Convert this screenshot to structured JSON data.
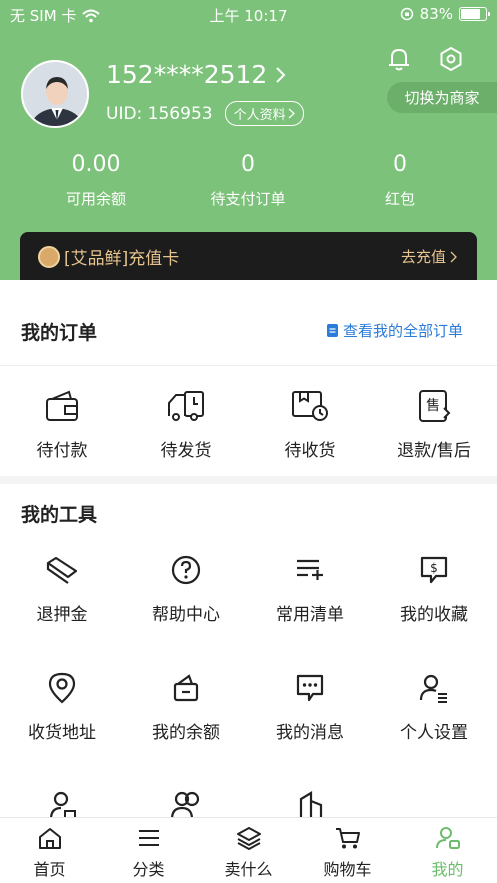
{
  "status_bar": {
    "carrier": "无 SIM 卡",
    "time": "上午 10:17",
    "battery": "83%",
    "battery_level": 0.83
  },
  "profile": {
    "phone": "152****2512",
    "uid": "UID: 156953",
    "profile_chip": "个人资料",
    "switch_label": "切换为商家"
  },
  "stats": [
    {
      "value": "0.00",
      "label": "可用余额"
    },
    {
      "value": "0",
      "label": "待支付订单"
    },
    {
      "value": "0",
      "label": "红包"
    }
  ],
  "recharge": {
    "label": "[艾品鲜]充值卡",
    "action": "去充值"
  },
  "orders": {
    "title": "我的订单",
    "view_all": "查看我的全部订单",
    "items": [
      {
        "label": "待付款",
        "icon": "wallet-icon"
      },
      {
        "label": "待发货",
        "icon": "truck-icon"
      },
      {
        "label": "待收货",
        "icon": "receive-icon"
      },
      {
        "label": "退款/售后",
        "icon": "after-sale-icon"
      }
    ]
  },
  "tools": {
    "title": "我的工具",
    "items": [
      {
        "label": "退押金",
        "icon": "deposit-icon"
      },
      {
        "label": "帮助中心",
        "icon": "help-icon"
      },
      {
        "label": "常用清单",
        "icon": "list-icon"
      },
      {
        "label": "我的收藏",
        "icon": "favorite-icon"
      },
      {
        "label": "收货地址",
        "icon": "location-icon"
      },
      {
        "label": "我的余额",
        "icon": "balance-icon"
      },
      {
        "label": "我的消息",
        "icon": "message-icon"
      },
      {
        "label": "个人设置",
        "icon": "user-settings-icon"
      }
    ]
  },
  "tabbar": {
    "items": [
      {
        "label": "首页",
        "icon": "home-icon"
      },
      {
        "label": "分类",
        "icon": "category-icon"
      },
      {
        "label": "卖什么",
        "icon": "layers-icon"
      },
      {
        "label": "购物车",
        "icon": "cart-icon"
      },
      {
        "label": "我的",
        "icon": "profile-icon"
      }
    ],
    "active_index": 4
  },
  "colors": {
    "header": "#7cc27a",
    "accent_green": "#6cbd6b",
    "link_blue": "#2b7bd9",
    "recharge_bg": "#1c1c1c",
    "recharge_text": "#e6c38f"
  }
}
